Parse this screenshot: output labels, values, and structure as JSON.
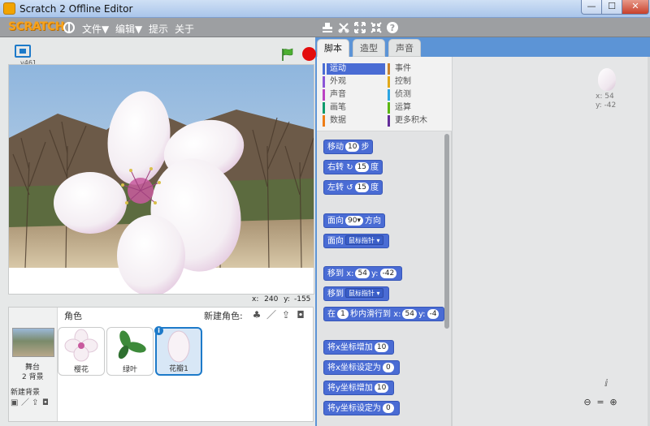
{
  "window": {
    "title": "Scratch 2 Offline Editor",
    "min": "—",
    "max": "☐",
    "close": "✕"
  },
  "menubar": {
    "logo": "SCRATCH",
    "file": "文件▼",
    "edit": "编辑▼",
    "tips": "提示",
    "about": "关于"
  },
  "stage": {
    "version": "v461",
    "x_label": "x:",
    "x_value": "240",
    "y_label": "y:",
    "y_value": "-155"
  },
  "sprites": {
    "header": "角色",
    "new_sprite_label": "新建角色:",
    "stage_label": "舞台",
    "stage_backdrops": "2 背景",
    "new_backdrop_label": "新建背景",
    "items": [
      {
        "name": "樱花"
      },
      {
        "name": "绿叶"
      },
      {
        "name": "花瓣1"
      }
    ]
  },
  "tabs": {
    "scripts": "脚本",
    "costumes": "造型",
    "sounds": "声音"
  },
  "categories": [
    {
      "label": "运动",
      "color": "#4a6cd4",
      "active": true
    },
    {
      "label": "事件",
      "color": "#c88330"
    },
    {
      "label": "外观",
      "color": "#8a55d7"
    },
    {
      "label": "控制",
      "color": "#e1a91a"
    },
    {
      "label": "声音",
      "color": "#bb42c3"
    },
    {
      "label": "侦测",
      "color": "#2ca5e2"
    },
    {
      "label": "画笔",
      "color": "#0e9a6c"
    },
    {
      "label": "运算",
      "color": "#5cb712"
    },
    {
      "label": "数据",
      "color": "#ee7d16"
    },
    {
      "label": "更多积木",
      "color": "#632d99"
    }
  ],
  "blocks": {
    "move": {
      "pre": "移动",
      "val": "10",
      "post": "步"
    },
    "turn_right": {
      "pre": "右转",
      "icon": "↻",
      "val": "15",
      "post": "度"
    },
    "turn_left": {
      "pre": "左转",
      "icon": "↺",
      "val": "15",
      "post": "度"
    },
    "point_dir": {
      "pre": "面向",
      "val": "90▾",
      "post": "方向"
    },
    "point_towards": {
      "pre": "面向",
      "dd": "鼠标指针 ▾"
    },
    "goto_xy": {
      "pre": "移到",
      "x": "x:",
      "xval": "54",
      "y": "y:",
      "yval": "-42"
    },
    "goto": {
      "pre": "移到",
      "dd": "鼠标指针 ▾"
    },
    "glide": {
      "pre": "在",
      "secs": "1",
      "mid": "秒内滑行到",
      "x": "x:",
      "xval": "54",
      "y": "y:",
      "yval": "-4"
    },
    "change_x": {
      "pre": "将x坐标增加",
      "val": "10"
    },
    "set_x": {
      "pre": "将x坐标设定为",
      "val": "0"
    },
    "change_y": {
      "pre": "将y坐标增加",
      "val": "10"
    },
    "set_y": {
      "pre": "将y坐标设定为",
      "val": "0"
    }
  },
  "scripts_area": {
    "sprite_x": "x: 54",
    "sprite_y": "y: -42"
  }
}
